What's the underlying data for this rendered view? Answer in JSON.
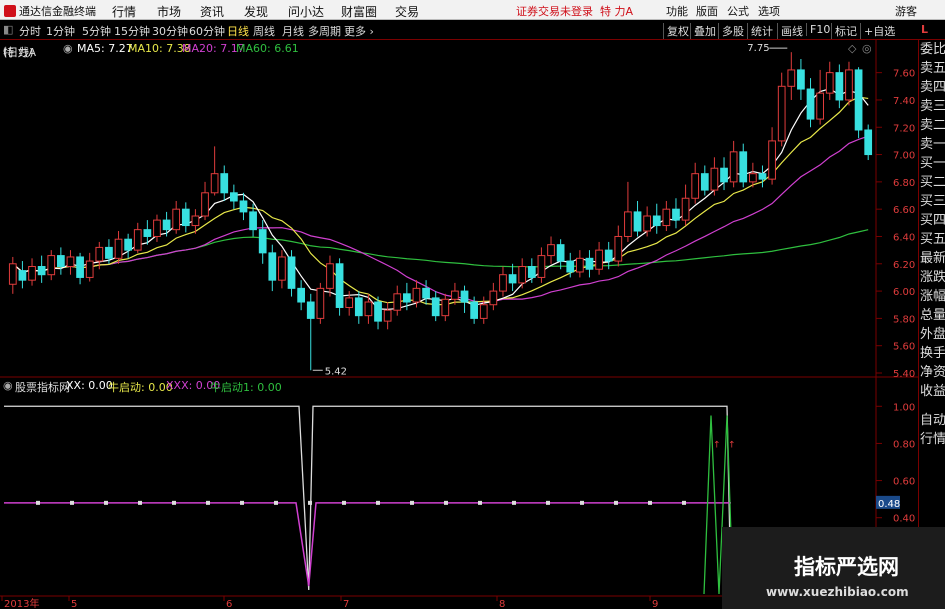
{
  "app": {
    "title": "通达信金融终端"
  },
  "menu": [
    "行情",
    "市场",
    "资讯",
    "发现",
    "问小达",
    "财富圈",
    "交易"
  ],
  "status": {
    "login": "证券交易未登录",
    "stock": "特 力A"
  },
  "right_menu": [
    "功能",
    "版面",
    "公式",
    "选项",
    "游客"
  ],
  "toolbar": {
    "periods": [
      "分时",
      "1分钟",
      "5分钟",
      "15分钟",
      "30分钟",
      "60分钟",
      "日线",
      "周线",
      "月线",
      "多周期",
      "更多"
    ],
    "buttons": [
      "复权",
      "叠加",
      "多股",
      "统计",
      "画线",
      "F10",
      "标记",
      "+自选"
    ],
    "side_marker": "L"
  },
  "indicator_line": {
    "stock_name": "特 力A",
    "period": "(日线)",
    "ma": [
      {
        "label": "MA5: 7.27",
        "color": "#ffffff"
      },
      {
        "label": "MA10: 7.38",
        "color": "#e8e84a"
      },
      {
        "label": "MA20: 7.17",
        "color": "#d040d0"
      },
      {
        "label": "MA60: 6.61",
        "color": "#2fbf3f"
      }
    ]
  },
  "sub_indicator": {
    "name": "股票指标网",
    "items": [
      {
        "label": "XX: 0.00",
        "color": "#ffffff"
      },
      {
        "label": "牛启动: 0.00",
        "color": "#e8e84a"
      },
      {
        "label": "XXX: 0.00",
        "color": "#d040d0"
      },
      {
        "label": "牛启动1: 0.00",
        "color": "#2fbf3f"
      }
    ]
  },
  "price_axis": [
    "7.60",
    "7.40",
    "7.20",
    "7.00",
    "6.80",
    "6.60",
    "6.40",
    "6.20",
    "6.00",
    "5.80",
    "5.60",
    "5.40"
  ],
  "sub_axis": [
    "1.00",
    "0.80",
    "0.60",
    "0.40"
  ],
  "sub_marker": "0.48",
  "annotations": {
    "high": "7.75",
    "low": "5.42"
  },
  "x_axis": [
    "2013年",
    "5",
    "6",
    "7",
    "8",
    "9"
  ],
  "right_panel": [
    "委比",
    "卖五",
    "卖四",
    "卖三",
    "卖二",
    "卖一",
    "买一",
    "买二",
    "买三",
    "买四",
    "买五",
    "最新",
    "涨跌",
    "涨幅",
    "总量",
    "外盘",
    "换手",
    "净资",
    "收益",
    "自动",
    "行情"
  ],
  "watermark": {
    "line1": "指标严选网",
    "line2": "www.xuezhibiao.com"
  },
  "colors": {
    "up": "#e03c3c",
    "down": "#38e0e0",
    "frame": "#7a0000",
    "ma5": "#ffffff",
    "ma10": "#e8e84a",
    "ma20": "#d040d0",
    "ma60": "#2fbf3f"
  },
  "chart_data": {
    "type": "candlestick",
    "y_range": [
      5.4,
      7.7
    ],
    "high_label": 7.75,
    "low_label": 5.42,
    "candles": [
      [
        6.05,
        6.2,
        6.25,
        5.98
      ],
      [
        6.15,
        6.08,
        6.22,
        6.02
      ],
      [
        6.08,
        6.18,
        6.24,
        6.04
      ],
      [
        6.18,
        6.12,
        6.26,
        6.06
      ],
      [
        6.12,
        6.26,
        6.3,
        6.08
      ],
      [
        6.26,
        6.18,
        6.32,
        6.12
      ],
      [
        6.18,
        6.25,
        6.3,
        6.12
      ],
      [
        6.25,
        6.1,
        6.28,
        6.05
      ],
      [
        6.1,
        6.22,
        6.28,
        6.07
      ],
      [
        6.22,
        6.32,
        6.36,
        6.16
      ],
      [
        6.32,
        6.24,
        6.38,
        6.2
      ],
      [
        6.24,
        6.38,
        6.44,
        6.2
      ],
      [
        6.38,
        6.3,
        6.42,
        6.24
      ],
      [
        6.3,
        6.45,
        6.5,
        6.28
      ],
      [
        6.45,
        6.4,
        6.52,
        6.34
      ],
      [
        6.4,
        6.52,
        6.56,
        6.36
      ],
      [
        6.52,
        6.45,
        6.58,
        6.4
      ],
      [
        6.45,
        6.6,
        6.66,
        6.42
      ],
      [
        6.6,
        6.48,
        6.65,
        6.43
      ],
      [
        6.48,
        6.55,
        6.6,
        6.42
      ],
      [
        6.55,
        6.72,
        6.8,
        6.52
      ],
      [
        6.72,
        6.86,
        7.06,
        6.7
      ],
      [
        6.86,
        6.72,
        6.92,
        6.66
      ],
      [
        6.72,
        6.66,
        6.78,
        6.6
      ],
      [
        6.66,
        6.58,
        6.72,
        6.52
      ],
      [
        6.58,
        6.45,
        6.64,
        6.4
      ],
      [
        6.45,
        6.28,
        6.52,
        6.2
      ],
      [
        6.28,
        6.08,
        6.34,
        6.0
      ],
      [
        6.08,
        6.25,
        6.3,
        6.02
      ],
      [
        6.25,
        6.02,
        6.3,
        5.96
      ],
      [
        6.02,
        5.92,
        6.08,
        5.86
      ],
      [
        5.92,
        5.8,
        5.98,
        5.42
      ],
      [
        5.8,
        6.02,
        6.06,
        5.76
      ],
      [
        6.02,
        6.2,
        6.26,
        5.96
      ],
      [
        6.2,
        5.88,
        6.24,
        5.82
      ],
      [
        5.88,
        5.95,
        6.0,
        5.82
      ],
      [
        5.95,
        5.82,
        6.0,
        5.76
      ],
      [
        5.82,
        5.92,
        5.98,
        5.76
      ],
      [
        5.92,
        5.78,
        5.96,
        5.72
      ],
      [
        5.78,
        5.86,
        5.92,
        5.72
      ],
      [
        5.86,
        5.98,
        6.04,
        5.82
      ],
      [
        5.98,
        5.92,
        6.06,
        5.86
      ],
      [
        5.92,
        6.02,
        6.08,
        5.88
      ],
      [
        6.02,
        5.95,
        6.08,
        5.9
      ],
      [
        5.95,
        5.82,
        6.0,
        5.78
      ],
      [
        5.82,
        5.94,
        5.98,
        5.78
      ],
      [
        5.94,
        6.0,
        6.06,
        5.9
      ],
      [
        6.0,
        5.92,
        6.04,
        5.84
      ],
      [
        5.92,
        5.8,
        5.96,
        5.76
      ],
      [
        5.8,
        5.9,
        5.96,
        5.76
      ],
      [
        5.9,
        6.0,
        6.06,
        5.86
      ],
      [
        6.0,
        6.12,
        6.18,
        5.96
      ],
      [
        6.12,
        6.06,
        6.2,
        6.0
      ],
      [
        6.06,
        6.18,
        6.24,
        6.02
      ],
      [
        6.18,
        6.1,
        6.24,
        6.06
      ],
      [
        6.1,
        6.26,
        6.32,
        6.06
      ],
      [
        6.26,
        6.34,
        6.4,
        6.2
      ],
      [
        6.34,
        6.22,
        6.38,
        6.16
      ],
      [
        6.22,
        6.14,
        6.28,
        6.1
      ],
      [
        6.14,
        6.24,
        6.3,
        6.1
      ],
      [
        6.24,
        6.16,
        6.3,
        6.1
      ],
      [
        6.16,
        6.3,
        6.36,
        6.12
      ],
      [
        6.3,
        6.22,
        6.36,
        6.16
      ],
      [
        6.22,
        6.4,
        6.48,
        6.18
      ],
      [
        6.4,
        6.58,
        6.8,
        6.36
      ],
      [
        6.58,
        6.44,
        6.66,
        6.4
      ],
      [
        6.44,
        6.55,
        6.62,
        6.4
      ],
      [
        6.55,
        6.48,
        6.64,
        6.42
      ],
      [
        6.48,
        6.6,
        6.66,
        6.44
      ],
      [
        6.6,
        6.52,
        6.68,
        6.46
      ],
      [
        6.52,
        6.68,
        6.78,
        6.48
      ],
      [
        6.68,
        6.86,
        6.94,
        6.64
      ],
      [
        6.86,
        6.74,
        6.92,
        6.7
      ],
      [
        6.74,
        6.9,
        6.98,
        6.7
      ],
      [
        6.9,
        6.8,
        6.98,
        6.74
      ],
      [
        6.8,
        7.02,
        7.1,
        6.76
      ],
      [
        7.02,
        6.8,
        7.08,
        6.76
      ],
      [
        6.8,
        6.86,
        6.94,
        6.76
      ],
      [
        6.86,
        6.82,
        6.92,
        6.76
      ],
      [
        6.82,
        7.1,
        7.2,
        6.78
      ],
      [
        7.1,
        7.5,
        7.6,
        7.06
      ],
      [
        7.5,
        7.62,
        7.75,
        7.4
      ],
      [
        7.62,
        7.48,
        7.7,
        7.4
      ],
      [
        7.48,
        7.26,
        7.56,
        7.2
      ],
      [
        7.26,
        7.45,
        7.62,
        7.22
      ],
      [
        7.45,
        7.6,
        7.68,
        7.4
      ],
      [
        7.6,
        7.4,
        7.66,
        7.34
      ],
      [
        7.4,
        7.62,
        7.68,
        7.36
      ],
      [
        7.62,
        7.18,
        7.64,
        7.12
      ],
      [
        7.18,
        7.0,
        7.22,
        6.96
      ]
    ]
  }
}
